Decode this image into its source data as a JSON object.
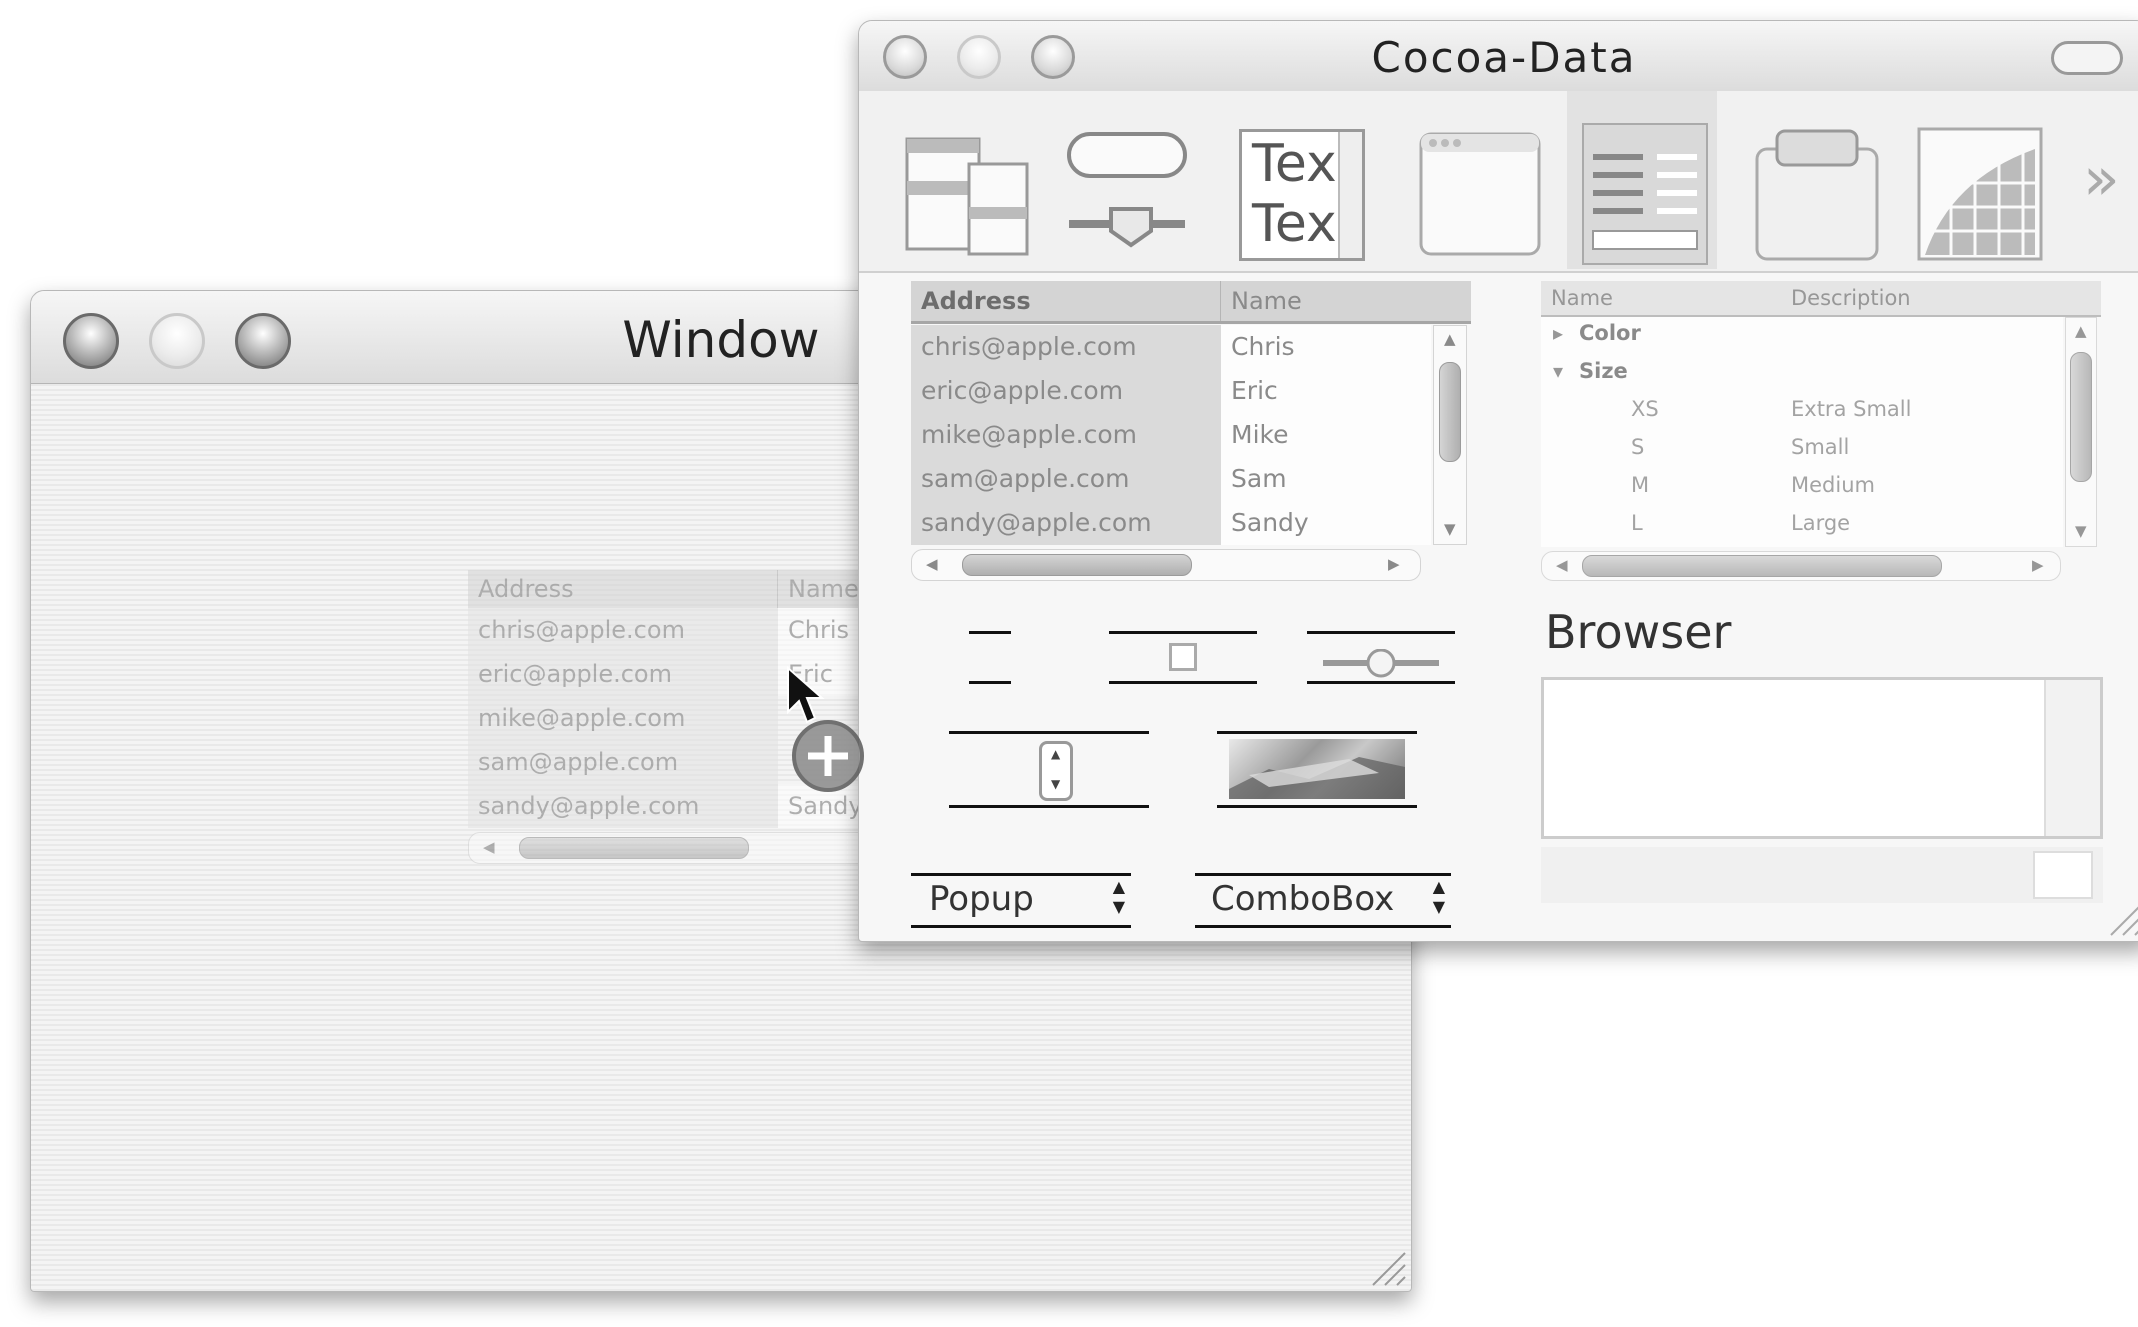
{
  "window": {
    "title": "Window",
    "drag_table": {
      "headers": [
        "Address",
        "Name"
      ],
      "rows": [
        [
          "chris@apple.com",
          "Chris"
        ],
        [
          "eric@apple.com",
          "Eric"
        ],
        [
          "mike@apple.com",
          ""
        ],
        [
          "sam@apple.com",
          ""
        ],
        [
          "sandy@apple.com",
          "Sandy"
        ]
      ]
    }
  },
  "palette": {
    "title": "Cocoa-Data",
    "toolbar_items": [
      "views-icon",
      "controls-icon",
      "text-icon",
      "windows-icon",
      "data-icon",
      "containers-icon",
      "graphics-icon"
    ],
    "more_label": "»",
    "text_icon_lines": [
      "Tex",
      "Tex"
    ],
    "table_view": {
      "headers": [
        "Address",
        "Name"
      ],
      "rows": [
        [
          "chris@apple.com",
          "Chris"
        ],
        [
          "eric@apple.com",
          "Eric"
        ],
        [
          "mike@apple.com",
          "Mike"
        ],
        [
          "sam@apple.com",
          "Sam"
        ],
        [
          "sandy@apple.com",
          "Sandy"
        ]
      ]
    },
    "outline_view": {
      "headers": [
        "Name",
        "Description"
      ],
      "rows": [
        {
          "name": "Color",
          "description": "",
          "disclosure": "▸"
        },
        {
          "name": "Size",
          "description": "",
          "disclosure": "▾"
        },
        {
          "name": "XS",
          "description": "Extra Small",
          "disclosure": ""
        },
        {
          "name": "S",
          "description": "Small",
          "disclosure": ""
        },
        {
          "name": "M",
          "description": "Medium",
          "disclosure": ""
        },
        {
          "name": "L",
          "description": "Large",
          "disclosure": ""
        }
      ]
    },
    "browser_label": "Browser",
    "popup_label": "Popup",
    "combobox_label": "ComboBox"
  },
  "colors": {
    "pinstripe_light": "#f4f4f4",
    "pinstripe_dark": "#e9e9e9",
    "header_bg": "#d9d9d9",
    "row_alt": "#efefef"
  }
}
